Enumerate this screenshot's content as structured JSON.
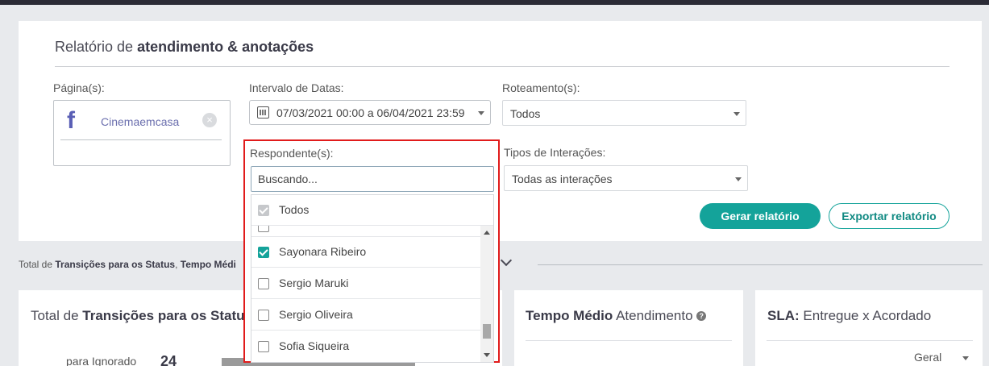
{
  "report": {
    "title_prefix": "Relatório de ",
    "title_bold": "atendimento & anotações"
  },
  "filters": {
    "pages_label": "Página(s):",
    "page_name": "Cinemaemcasa",
    "date_label": "Intervalo de Datas:",
    "date_value": "07/03/2021 00:00 a 06/04/2021 23:59",
    "routing_label": "Roteamento(s):",
    "routing_value": "Todos",
    "respondents_label": "Respondente(s):",
    "search_placeholder": "Buscando...",
    "interaction_label": "Tipos de Interações:",
    "interaction_value": "Todas as interações"
  },
  "respondents": {
    "all_label": "Todos",
    "options": [
      {
        "label": "Sayonara Ribeiro",
        "checked": true
      },
      {
        "label": "Sergio Maruki",
        "checked": false
      },
      {
        "label": "Sergio Oliveira",
        "checked": false
      },
      {
        "label": "Sofia Siqueira",
        "checked": false
      }
    ]
  },
  "actions": {
    "generate": "Gerar relatório",
    "export": "Exportar relatório"
  },
  "section": {
    "prefix": "Total de ",
    "bold1": "Transições para os Status",
    "sep": ", ",
    "bold2": "Tempo Médi"
  },
  "cards": {
    "transitions_prefix": "Total de ",
    "transitions_bold": "Transições para os Status",
    "transitions_row_label": "para Ignorado",
    "transitions_row_value": "24",
    "avg_bold": "Tempo Médio",
    "avg_rest": " Atendimento",
    "sla_bold": "SLA:",
    "sla_rest": " Entregue x Acordado",
    "sla_select": "Geral"
  },
  "colors": {
    "accent": "#14a39a",
    "highlight_border": "#e11b1b"
  }
}
